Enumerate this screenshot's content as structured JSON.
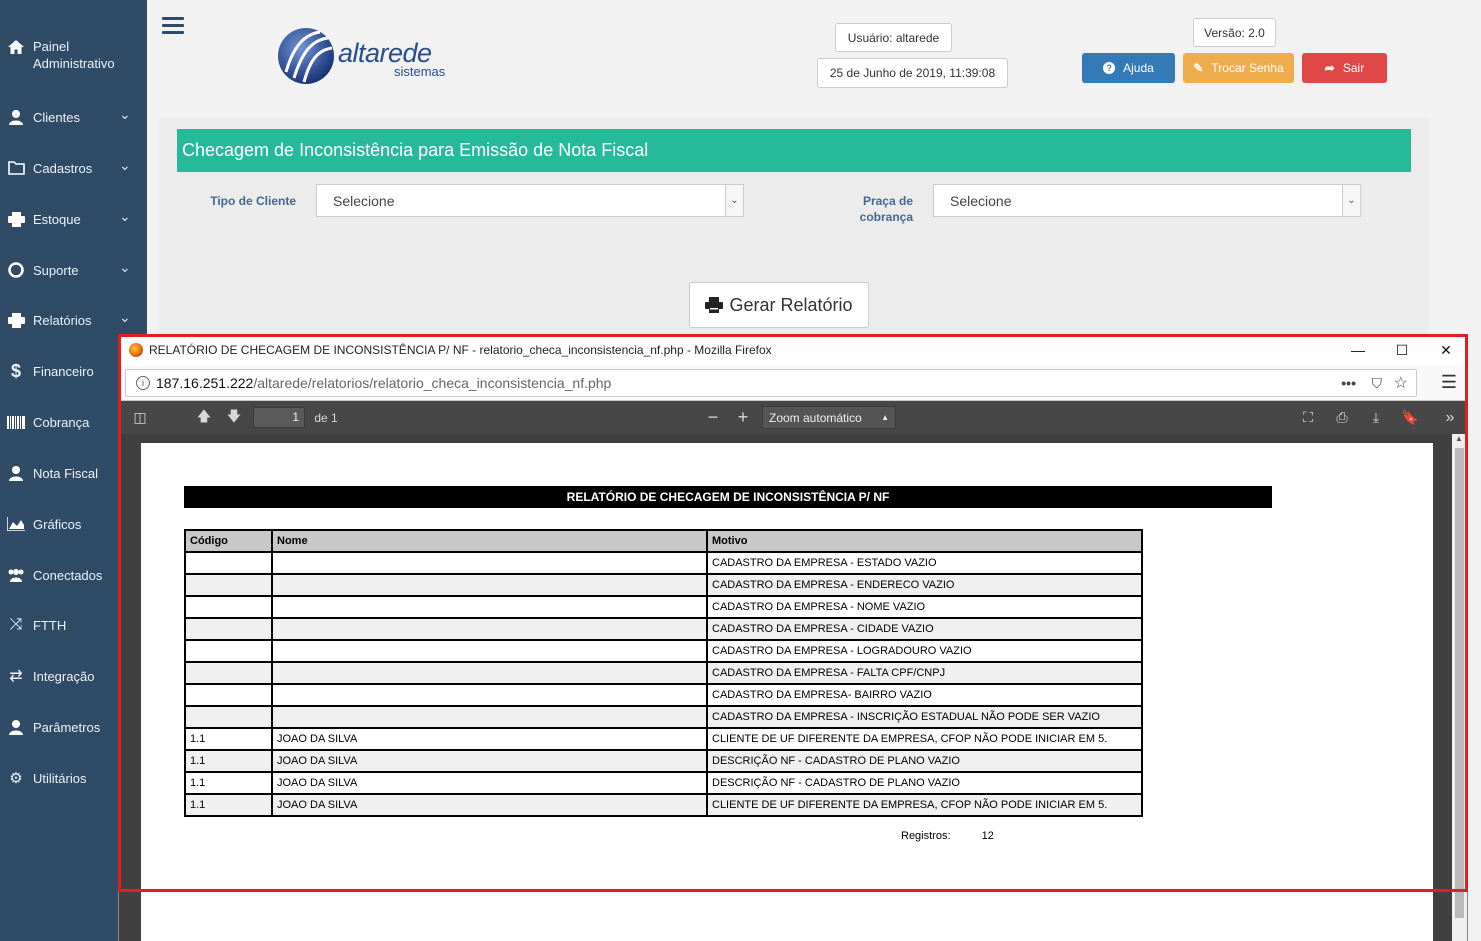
{
  "sidebar": {
    "items": [
      {
        "label": "Painel Administrativo",
        "icon": "home-icon",
        "chevron": false
      },
      {
        "label": "Clientes",
        "icon": "user-icon",
        "chevron": true
      },
      {
        "label": "Cadastros",
        "icon": "folder-icon",
        "chevron": true
      },
      {
        "label": "Estoque",
        "icon": "print-icon",
        "chevron": true
      },
      {
        "label": "Suporte",
        "icon": "lifebuoy-icon",
        "chevron": true
      },
      {
        "label": "Relatórios",
        "icon": "print-icon",
        "chevron": true
      },
      {
        "label": "Financeiro",
        "icon": "dollar-icon",
        "chevron": false
      },
      {
        "label": "Cobrança",
        "icon": "barcode-icon",
        "chevron": false
      },
      {
        "label": "Nota Fiscal",
        "icon": "user-icon",
        "chevron": false
      },
      {
        "label": "Gráficos",
        "icon": "area-chart-icon",
        "chevron": false
      },
      {
        "label": "Conectados",
        "icon": "users-icon",
        "chevron": false
      },
      {
        "label": "FTTH",
        "icon": "shuffle-icon",
        "chevron": false
      },
      {
        "label": "Integração",
        "icon": "exchange-icon",
        "chevron": false
      },
      {
        "label": "Parâmetros",
        "icon": "user-icon",
        "chevron": false
      },
      {
        "label": "Utilitários",
        "icon": "cogs-icon",
        "chevron": false
      }
    ]
  },
  "header": {
    "logo_word": "altarede",
    "logo_sub": "sistemas",
    "user": "Usuário: altarede",
    "datetime": "25 de Junho de 2019, 11:39:08",
    "version": "Versão: 2.0",
    "help_label": "Ajuda",
    "change_password_label": "Trocar Senha",
    "logout_label": "Sair",
    "colors": {
      "help": "#337ab7",
      "change_password": "#f0ad4e",
      "logout": "#e04848"
    }
  },
  "form": {
    "title": "Checagem de Inconsistência para Emissão de Nota Fiscal",
    "client_type_label": "Tipo de Cliente",
    "client_type_value": "Selecione",
    "square_label_1": "Praça de",
    "square_label_2": "cobrança",
    "square_value": "Selecione",
    "generate_label": "Gerar Relatório"
  },
  "firefox": {
    "title": "RELATÓRIO DE CHECAGEM DE INCONSISTÊNCIA P/ NF - relatorio_checa_inconsistencia_nf.php - Mozilla Firefox",
    "url_host": "187.16.251.222",
    "url_path": "/altarede/relatorios/relatorio_checa_inconsistencia_nf.php",
    "page_number": "1",
    "page_of": "de 1",
    "zoom": "Zoom automático"
  },
  "report": {
    "title": "RELATÓRIO DE CHECAGEM DE INCONSISTÊNCIA P/ NF",
    "columns": [
      "Código",
      "Nome",
      "Motivo"
    ],
    "rows": [
      [
        "",
        "",
        "CADASTRO DA EMPRESA - ESTADO VAZIO"
      ],
      [
        "",
        "",
        "CADASTRO DA EMPRESA - ENDERECO VAZIO"
      ],
      [
        "",
        "",
        "CADASTRO DA EMPRESA - NOME VAZIO"
      ],
      [
        "",
        "",
        "CADASTRO DA EMPRESA - CIDADE VAZIO"
      ],
      [
        "",
        "",
        "CADASTRO DA EMPRESA - LOGRADOURO VAZIO"
      ],
      [
        "",
        "",
        "CADASTRO DA EMPRESA - FALTA CPF/CNPJ"
      ],
      [
        "",
        "",
        "CADASTRO DA EMPRESA- BAIRRO VAZIO"
      ],
      [
        "",
        "",
        "CADASTRO DA EMPRESA - INSCRIÇÃO ESTADUAL NÃO PODE SER VAZIO"
      ],
      [
        "1.1",
        "JOAO DA SILVA",
        "CLIENTE DE UF DIFERENTE DA EMPRESA, CFOP NÃO PODE INICIAR EM 5."
      ],
      [
        "1.1",
        "JOAO DA SILVA",
        "DESCRIÇÃO NF - CADASTRO DE PLANO VAZIO"
      ],
      [
        "1.1",
        "JOAO DA SILVA",
        "DESCRIÇÃO NF - CADASTRO DE PLANO VAZIO"
      ],
      [
        "1.1",
        "JOAO DA SILVA",
        "CLIENTE DE UF DIFERENTE DA EMPRESA, CFOP NÃO PODE INICIAR EM 5."
      ]
    ],
    "records_label": "Registros:",
    "records_count": "12"
  }
}
